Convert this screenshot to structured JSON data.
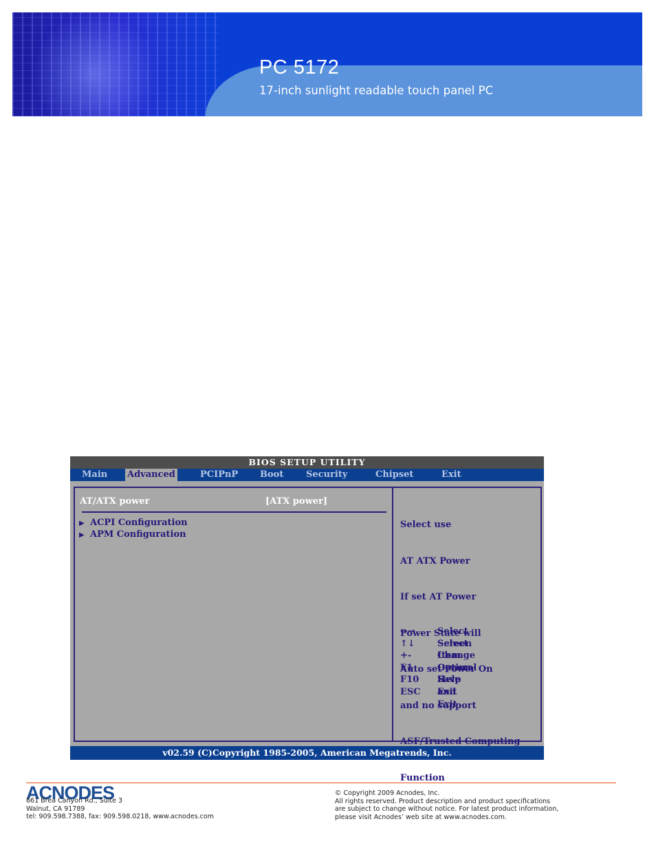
{
  "header": {
    "title": "PC 5172",
    "subtitle": "17-inch sunlight readable touch panel PC"
  },
  "bios": {
    "title": "BIOS SETUP UTILITY",
    "tabs": [
      {
        "label": "Main",
        "active": false
      },
      {
        "label": "Advanced",
        "active": true
      },
      {
        "label": "PCIPnP",
        "active": false
      },
      {
        "label": "Boot",
        "active": false
      },
      {
        "label": "Security",
        "active": false
      },
      {
        "label": "Chipset",
        "active": false
      },
      {
        "label": "Exit",
        "active": false
      }
    ],
    "setting": {
      "label": "AT/ATX power",
      "value": "[ATX power]"
    },
    "submenus": [
      {
        "label": "ACPI Configuration"
      },
      {
        "label": "APM Configuration"
      }
    ],
    "help_lines": [
      "Select use",
      "AT ATX Power",
      "If set AT Power",
      "Power State will",
      "Auto set Power On",
      "and no support",
      "ASF/Trusted Computing",
      "Function"
    ],
    "keys": [
      {
        "key": "←→",
        "desc": "Select Screen"
      },
      {
        "key": "↑↓",
        "desc": "Select Item"
      },
      {
        "key": "+-",
        "desc": "Change Option"
      },
      {
        "key": "F1",
        "desc": "General Help"
      },
      {
        "key": "F10",
        "desc": "Save and Exit"
      },
      {
        "key": "ESC",
        "desc": "Exit"
      }
    ],
    "status": "v02.59 (C)Copyright 1985-2005, American Megatrends, Inc."
  },
  "footer": {
    "logo": "ACNODES",
    "address": [
      "661 Brea Canyon Rd., Suite 3",
      "Walnut, CA 91789",
      "tel: 909.598.7388, fax: 909.598.0218, www.acnodes.com"
    ],
    "copyright": [
      "© Copyright 2009 Acnodes, Inc.",
      "All rights reserved. Product description and product specifications",
      "are subject to change without notice. For latest product information,",
      "please visit Acnodes’ web site at www.acnodes.com."
    ]
  }
}
